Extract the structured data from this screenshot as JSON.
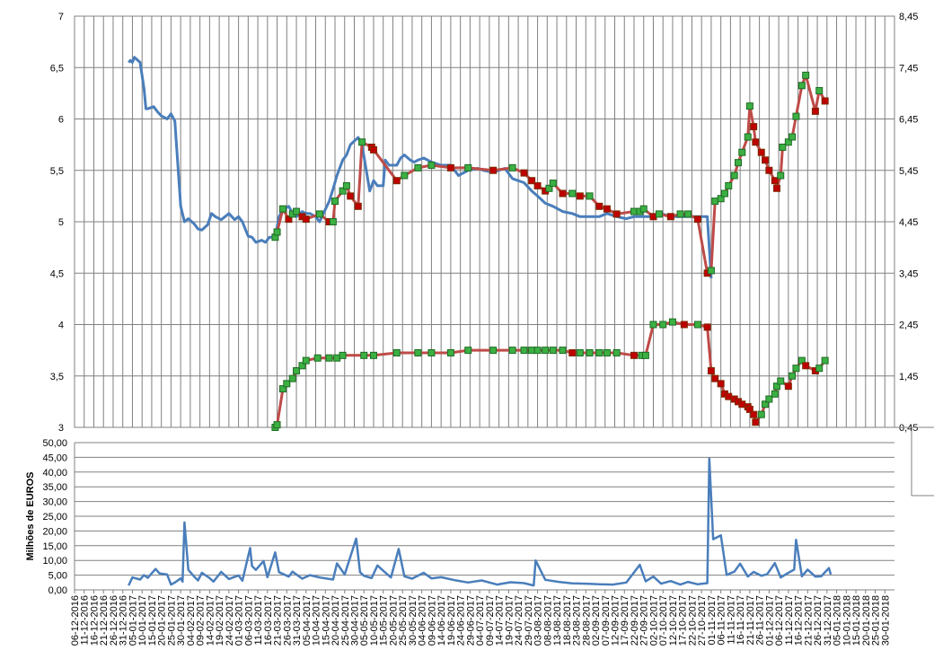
{
  "chart_data": [
    {
      "type": "line",
      "title": "",
      "left_axis": {
        "ylim": [
          3,
          7
        ],
        "ticks": [
          "3",
          "3,5",
          "4",
          "4,5",
          "5",
          "5,5",
          "6",
          "6,5",
          "7"
        ]
      },
      "right_axis": {
        "ylim": [
          0.45,
          8.45
        ],
        "ticks": [
          "0,45",
          "1,45",
          "2,45",
          "3,45",
          "4,45",
          "5,45",
          "6,45",
          "7,45",
          "8,45"
        ]
      },
      "grid": true,
      "legend": "none",
      "x_is_date": true,
      "series": [
        {
          "axis": "left",
          "color": "#4A7EBB",
          "marker": "none",
          "x": [
            "2017-01-03",
            "2017-01-04",
            "2017-01-05",
            "2017-01-06",
            "2017-01-09",
            "2017-01-11",
            "2017-01-12",
            "2017-01-13",
            "2017-01-16",
            "2017-01-18",
            "2017-01-20",
            "2017-01-23",
            "2017-01-25",
            "2017-01-27",
            "2017-01-30",
            "2017-02-01",
            "2017-02-03",
            "2017-02-06",
            "2017-02-08",
            "2017-02-10",
            "2017-02-13",
            "2017-02-15",
            "2017-02-17",
            "2017-02-20",
            "2017-02-22",
            "2017-02-24",
            "2017-02-27",
            "2017-03-01",
            "2017-03-03",
            "2017-03-06",
            "2017-03-08",
            "2017-03-10",
            "2017-03-13",
            "2017-03-15",
            "2017-03-17",
            "2017-03-20",
            "2017-03-22",
            "2017-03-24",
            "2017-03-27",
            "2017-03-29",
            "2017-03-31",
            "2017-04-03",
            "2017-04-05",
            "2017-04-07",
            "2017-04-10",
            "2017-04-12",
            "2017-04-17",
            "2017-04-19",
            "2017-04-21",
            "2017-04-24",
            "2017-04-26",
            "2017-04-28",
            "2017-05-02",
            "2017-05-04",
            "2017-05-08",
            "2017-05-10",
            "2017-05-12",
            "2017-05-15",
            "2017-05-16",
            "2017-05-18",
            "2017-05-22",
            "2017-05-24",
            "2017-05-26",
            "2017-05-29",
            "2017-05-31",
            "2017-06-02",
            "2017-06-05",
            "2017-06-09",
            "2017-06-14",
            "2017-06-19",
            "2017-06-23",
            "2017-06-28",
            "2017-07-03",
            "2017-07-06",
            "2017-07-11",
            "2017-07-17",
            "2017-07-21",
            "2017-07-27",
            "2017-07-31",
            "2017-08-03",
            "2017-08-07",
            "2017-08-11",
            "2017-08-16",
            "2017-08-21",
            "2017-08-25",
            "2017-08-30",
            "2017-09-04",
            "2017-09-08",
            "2017-09-13",
            "2017-09-18",
            "2017-09-22",
            "2017-09-27",
            "2017-10-02",
            "2017-10-06",
            "2017-10-11",
            "2017-10-16",
            "2017-10-20",
            "2017-10-25",
            "2017-10-30",
            "2017-11-01"
          ],
          "values": [
            6.55,
            6.57,
            6.55,
            6.6,
            6.55,
            6.3,
            6.1,
            6.1,
            6.12,
            6.07,
            6.03,
            6.0,
            6.05,
            5.98,
            5.15,
            5.0,
            5.03,
            4.98,
            4.93,
            4.92,
            4.97,
            5.08,
            5.05,
            5.02,
            5.05,
            5.08,
            5.02,
            5.05,
            5.0,
            4.86,
            4.85,
            4.8,
            4.82,
            4.8,
            4.85,
            4.85,
            5.05,
            5.12,
            5.15,
            5.08,
            5.05,
            5.1,
            5.08,
            5.08,
            5.05,
            5.0,
            5.2,
            5.32,
            5.45,
            5.6,
            5.65,
            5.75,
            5.82,
            5.75,
            5.3,
            5.4,
            5.35,
            5.35,
            5.6,
            5.55,
            5.55,
            5.62,
            5.65,
            5.6,
            5.58,
            5.6,
            5.62,
            5.58,
            5.55,
            5.55,
            5.45,
            5.5,
            5.52,
            5.5,
            5.48,
            5.52,
            5.42,
            5.38,
            5.3,
            5.25,
            5.18,
            5.15,
            5.1,
            5.08,
            5.05,
            5.05,
            5.05,
            5.08,
            5.05,
            5.03,
            5.05,
            5.05,
            5.05,
            5.08,
            5.05,
            5.05,
            5.05,
            5.05,
            5.05,
            4.45
          ]
        },
        {
          "axis": "right",
          "color": "#BE4B48",
          "marker": "square",
          "x": [
            "2017-03-20",
            "2017-03-21",
            "2017-03-24",
            "2017-03-27",
            "2017-03-29",
            "2017-03-31",
            "2017-04-03",
            "2017-04-05",
            "2017-04-12",
            "2017-04-17",
            "2017-04-19",
            "2017-04-20",
            "2017-04-24",
            "2017-04-26",
            "2017-04-28",
            "2017-05-02",
            "2017-05-04",
            "2017-05-09",
            "2017-05-10",
            "2017-05-22",
            "2017-05-26",
            "2017-06-02",
            "2017-06-09",
            "2017-06-19",
            "2017-06-28",
            "2017-07-11",
            "2017-07-21",
            "2017-07-27",
            "2017-07-31",
            "2017-08-03",
            "2017-08-07",
            "2017-08-09",
            "2017-08-11",
            "2017-08-16",
            "2017-08-21",
            "2017-08-25",
            "2017-08-30",
            "2017-09-04",
            "2017-09-08",
            "2017-09-13",
            "2017-09-22",
            "2017-09-25",
            "2017-09-27",
            "2017-10-02",
            "2017-10-05",
            "2017-10-11",
            "2017-10-16",
            "2017-10-20",
            "2017-10-25",
            "2017-10-30",
            "2017-11-01",
            "2017-11-03",
            "2017-11-06",
            "2017-11-08",
            "2017-11-10",
            "2017-11-13",
            "2017-11-15",
            "2017-11-17",
            "2017-11-20",
            "2017-11-21",
            "2017-11-23",
            "2017-11-24",
            "2017-11-27",
            "2017-11-29",
            "2017-12-01",
            "2017-12-04",
            "2017-12-05",
            "2017-12-07",
            "2017-12-08",
            "2017-12-11",
            "2017-12-13",
            "2017-12-15",
            "2017-12-18",
            "2017-12-20",
            "2017-12-25",
            "2017-12-27",
            "2017-12-30"
          ],
          "values": [
            4.15,
            4.25,
            4.7,
            4.5,
            4.6,
            4.65,
            4.55,
            4.5,
            4.6,
            4.45,
            4.45,
            4.85,
            5.05,
            5.15,
            4.95,
            4.75,
            6.0,
            5.9,
            5.85,
            5.25,
            5.35,
            5.5,
            5.55,
            5.5,
            5.5,
            5.45,
            5.5,
            5.4,
            5.25,
            5.15,
            5.05,
            5.1,
            5.2,
            5.0,
            5.0,
            4.95,
            4.95,
            4.75,
            4.7,
            4.6,
            4.65,
            4.65,
            4.7,
            4.55,
            4.6,
            4.55,
            4.6,
            4.6,
            4.5,
            3.45,
            3.5,
            4.85,
            4.9,
            5.0,
            5.15,
            5.35,
            5.6,
            5.8,
            6.1,
            6.7,
            6.3,
            6.0,
            5.8,
            5.65,
            5.45,
            5.25,
            5.1,
            5.35,
            5.9,
            6.0,
            6.1,
            6.5,
            7.1,
            7.3,
            6.6,
            7.0,
            6.8
          ]
        },
        {
          "axis": "right",
          "color": "#BE4B48",
          "marker": "square",
          "x": [
            "2017-03-20",
            "2017-03-21",
            "2017-03-24",
            "2017-03-26",
            "2017-03-29",
            "2017-03-31",
            "2017-04-03",
            "2017-04-05",
            "2017-04-11",
            "2017-04-17",
            "2017-04-21",
            "2017-04-24",
            "2017-05-05",
            "2017-05-10",
            "2017-05-22",
            "2017-06-02",
            "2017-06-09",
            "2017-06-19",
            "2017-06-28",
            "2017-07-11",
            "2017-07-21",
            "2017-07-27",
            "2017-07-31",
            "2017-08-03",
            "2017-08-07",
            "2017-08-11",
            "2017-08-16",
            "2017-08-21",
            "2017-08-25",
            "2017-08-30",
            "2017-09-04",
            "2017-09-08",
            "2017-09-13",
            "2017-09-22",
            "2017-09-26",
            "2017-09-28",
            "2017-10-02",
            "2017-10-07",
            "2017-10-12",
            "2017-10-18",
            "2017-10-25",
            "2017-10-30",
            "2017-11-01",
            "2017-11-03",
            "2017-11-06",
            "2017-11-08",
            "2017-11-10",
            "2017-11-13",
            "2017-11-15",
            "2017-11-17",
            "2017-11-20",
            "2017-11-21",
            "2017-11-23",
            "2017-11-24",
            "2017-11-27",
            "2017-11-29",
            "2017-12-01",
            "2017-12-04",
            "2017-12-05",
            "2017-12-07",
            "2017-12-11",
            "2017-12-13",
            "2017-12-15",
            "2017-12-18",
            "2017-12-20",
            "2017-12-25",
            "2017-12-27",
            "2017-12-30"
          ],
          "values": [
            0.45,
            0.5,
            1.2,
            1.3,
            1.4,
            1.55,
            1.65,
            1.75,
            1.8,
            1.8,
            1.8,
            1.85,
            1.85,
            1.85,
            1.9,
            1.9,
            1.9,
            1.9,
            1.95,
            1.95,
            1.95,
            1.95,
            1.95,
            1.95,
            1.95,
            1.95,
            1.95,
            1.9,
            1.9,
            1.9,
            1.9,
            1.9,
            1.9,
            1.85,
            1.85,
            1.85,
            2.45,
            2.45,
            2.5,
            2.45,
            2.45,
            2.4,
            1.55,
            1.4,
            1.3,
            1.1,
            1.05,
            1.0,
            0.95,
            0.9,
            0.85,
            0.8,
            0.7,
            0.55,
            0.7,
            0.9,
            1.0,
            1.1,
            1.25,
            1.35,
            1.25,
            1.45,
            1.6,
            1.75,
            1.65,
            1.55,
            1.6,
            1.75
          ]
        }
      ]
    },
    {
      "type": "line",
      "title": "",
      "ylabel": "Milhões de EUROS",
      "ylim": [
        0,
        50
      ],
      "y_ticks": [
        "0,00",
        "5,00",
        "10,00",
        "15,00",
        "20,00",
        "25,00",
        "30,00",
        "35,00",
        "40,00",
        "45,00",
        "50,00"
      ],
      "x_ticks": [
        "06-12-2016",
        "11-12-2016",
        "16-12-2016",
        "21-12-2016",
        "26-12-2016",
        "31-12-2016",
        "05-01-2017",
        "10-01-2017",
        "15-01-2017",
        "20-01-2017",
        "25-01-2017",
        "30-01-2017",
        "04-02-2017",
        "09-02-2017",
        "14-02-2017",
        "19-02-2017",
        "24-02-2017",
        "01-03-2017",
        "06-03-2017",
        "11-03-2017",
        "16-03-2017",
        "21-03-2017",
        "26-03-2017",
        "31-03-2017",
        "05-04-2017",
        "10-04-2017",
        "15-04-2017",
        "20-04-2017",
        "25-04-2017",
        "30-04-2017",
        "05-05-2017",
        "10-05-2017",
        "15-05-2017",
        "20-05-2017",
        "25-05-2017",
        "30-05-2017",
        "04-06-2017",
        "09-06-2017",
        "14-06-2017",
        "19-06-2017",
        "24-06-2017",
        "29-06-2017",
        "04-07-2017",
        "09-07-2017",
        "14-07-2017",
        "19-07-2017",
        "24-07-2017",
        "29-07-2017",
        "03-08-2017",
        "08-08-2017",
        "13-08-2017",
        "18-08-2017",
        "23-08-2017",
        "28-08-2017",
        "02-09-2017",
        "07-09-2017",
        "12-09-2017",
        "17-09-2017",
        "22-09-2017",
        "27-09-2017",
        "02-10-2017",
        "07-10-2017",
        "12-10-2017",
        "17-10-2017",
        "22-10-2017",
        "27-10-2017",
        "01-11-2017",
        "06-11-2017",
        "11-11-2017",
        "16-11-2017",
        "21-11-2017",
        "26-11-2017",
        "01-12-2017",
        "06-12-2017",
        "11-12-2017",
        "16-12-2017",
        "21-12-2017",
        "26-12-2017",
        "31-12-2017",
        "05-01-2018",
        "10-01-2018",
        "15-01-2018",
        "20-01-2018",
        "25-01-2018",
        "30-01-2018"
      ],
      "grid": true,
      "legend": "none",
      "x_is_date": true,
      "series": [
        {
          "color": "#4A7EBB",
          "x": [
            "2017-01-03",
            "2017-01-05",
            "2017-01-09",
            "2017-01-11",
            "2017-01-13",
            "2017-01-17",
            "2017-01-19",
            "2017-01-23",
            "2017-01-25",
            "2017-01-27",
            "2017-01-30",
            "2017-01-31",
            "2017-02-01",
            "2017-02-03",
            "2017-02-06",
            "2017-02-08",
            "2017-02-10",
            "2017-02-14",
            "2017-02-16",
            "2017-02-20",
            "2017-02-24",
            "2017-03-01",
            "2017-03-03",
            "2017-03-07",
            "2017-03-08",
            "2017-03-10",
            "2017-03-14",
            "2017-03-16",
            "2017-03-20",
            "2017-03-22",
            "2017-03-27",
            "2017-03-29",
            "2017-04-03",
            "2017-04-07",
            "2017-04-12",
            "2017-04-19",
            "2017-04-21",
            "2017-04-25",
            "2017-05-01",
            "2017-05-03",
            "2017-05-05",
            "2017-05-09",
            "2017-05-12",
            "2017-05-15",
            "2017-05-19",
            "2017-05-23",
            "2017-05-26",
            "2017-05-30",
            "2017-06-05",
            "2017-06-09",
            "2017-06-14",
            "2017-06-21",
            "2017-06-28",
            "2017-07-05",
            "2017-07-13",
            "2017-07-20",
            "2017-07-27",
            "2017-08-01",
            "2017-08-02",
            "2017-08-07",
            "2017-08-14",
            "2017-08-21",
            "2017-08-28",
            "2017-09-04",
            "2017-09-11",
            "2017-09-18",
            "2017-09-25",
            "2017-09-28",
            "2017-10-02",
            "2017-10-06",
            "2017-10-11",
            "2017-10-16",
            "2017-10-20",
            "2017-10-25",
            "2017-10-30",
            "2017-10-31",
            "2017-11-02",
            "2017-11-06",
            "2017-11-09",
            "2017-11-13",
            "2017-11-16",
            "2017-11-20",
            "2017-11-23",
            "2017-11-27",
            "2017-11-30",
            "2017-12-04",
            "2017-12-07",
            "2017-12-11",
            "2017-12-14",
            "2017-12-15",
            "2017-12-18",
            "2017-12-21",
            "2017-12-25",
            "2017-12-28",
            "2018-01-01",
            "2018-01-02"
          ],
          "values": [
            1.5,
            4.2,
            3.5,
            5.0,
            4.1,
            7.1,
            5.6,
            5.2,
            1.8,
            2.5,
            3.9,
            2.8,
            22.9,
            6.8,
            4.5,
            3.2,
            5.8,
            4.0,
            2.8,
            6.1,
            3.7,
            4.9,
            3.1,
            14.2,
            8.1,
            6.8,
            9.8,
            4.3,
            12.7,
            6.0,
            4.5,
            6.2,
            3.8,
            5.0,
            4.2,
            3.5,
            9.0,
            5.2,
            17.4,
            6.0,
            4.8,
            4.0,
            8.3,
            6.5,
            4.2,
            13.9,
            4.6,
            3.8,
            5.8,
            3.9,
            4.3,
            3.3,
            2.5,
            3.2,
            1.8,
            2.6,
            2.3,
            1.5,
            10.0,
            3.4,
            2.7,
            2.2,
            2.1,
            1.9,
            1.8,
            2.5,
            8.5,
            2.9,
            4.5,
            2.1,
            3.0,
            1.8,
            2.7,
            1.9,
            2.3,
            44.6,
            17.2,
            18.5,
            5.1,
            6.2,
            8.9,
            4.5,
            6.1,
            4.8,
            5.3,
            9.1,
            4.2,
            5.8,
            6.9,
            17.0,
            4.6,
            6.9,
            4.5,
            4.6,
            7.4,
            5.2
          ]
        }
      ]
    }
  ]
}
